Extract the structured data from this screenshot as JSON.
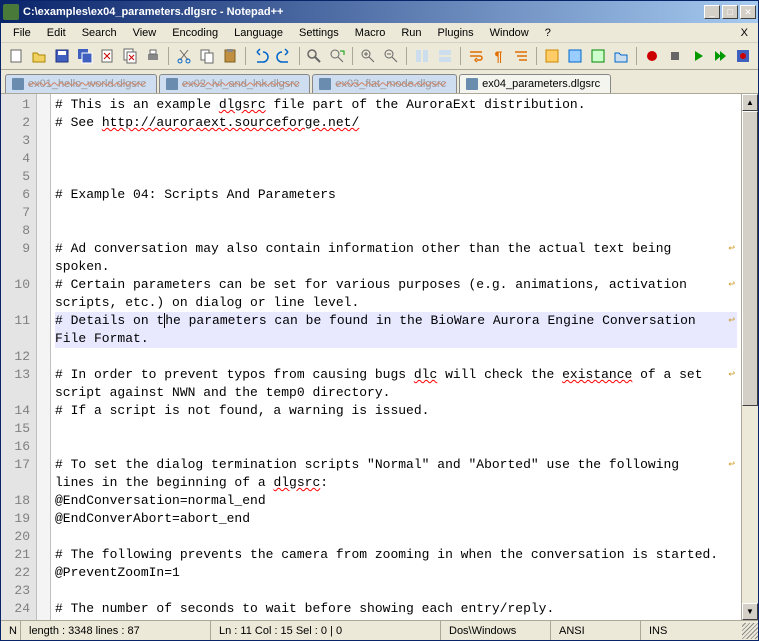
{
  "window": {
    "title": "C:\\examples\\ex04_parameters.dlgsrc - Notepad++"
  },
  "menu": {
    "items": [
      "File",
      "Edit",
      "Search",
      "View",
      "Encoding",
      "Language",
      "Settings",
      "Macro",
      "Run",
      "Plugins",
      "Window",
      "?"
    ],
    "close_x": "X"
  },
  "tabs": [
    {
      "label": "ex01_hello_world.dlgsrc",
      "active": false
    },
    {
      "label": "ex02_lvl_and_lnk.dlgsrc",
      "active": false
    },
    {
      "label": "ex03_flat_mode.dlgsrc",
      "active": false
    },
    {
      "label": "ex04_parameters.dlgsrc",
      "active": true
    }
  ],
  "editor": {
    "lines": [
      {
        "n": 1,
        "text": "# This is an example ",
        "spell": "dlgsrc",
        "rest": " file part of the AuroraExt distribution."
      },
      {
        "n": 2,
        "text": "# See ",
        "spell": "http://auroraext.sourceforge.net/",
        "rest": ""
      },
      {
        "n": 3,
        "text": ""
      },
      {
        "n": 4,
        "text": ""
      },
      {
        "n": 5,
        "text": ""
      },
      {
        "n": 6,
        "text": "# Example 04: Scripts And Parameters"
      },
      {
        "n": 7,
        "text": ""
      },
      {
        "n": 8,
        "text": ""
      },
      {
        "n": 9,
        "text": "# Ad conversation may also contain information other than the actual text being",
        "wrap": true
      },
      {
        "n": "",
        "text": "spoken."
      },
      {
        "n": 10,
        "text": "# Certain parameters can be set for various purposes (e.g. animations, activation",
        "wrap": true
      },
      {
        "n": "",
        "text": "scripts, etc.) on dialog or line level."
      },
      {
        "n": 11,
        "text": "# Details on the parameters can be found in the BioWare Aurora Engine Conversation",
        "current": true,
        "wrap": true,
        "cursor_at": 14
      },
      {
        "n": "",
        "text": "File Format.",
        "current": true
      },
      {
        "n": 12,
        "text": ""
      },
      {
        "n": 13,
        "text": "# In order to prevent typos from causing bugs ",
        "spell": "dlc",
        "rest": " will check the ",
        "spell2": "existance",
        "rest2": " of a set",
        "wrap": true
      },
      {
        "n": "",
        "text": "script against NWN and the temp0 directory."
      },
      {
        "n": 14,
        "text": "# If a script is not found, a warning is issued."
      },
      {
        "n": 15,
        "text": ""
      },
      {
        "n": 16,
        "text": ""
      },
      {
        "n": 17,
        "text": "# To set the dialog termination scripts \"Normal\" and \"Aborted\" use the following",
        "wrap": true
      },
      {
        "n": "",
        "text": "lines in the beginning of a ",
        "spell": "dlgsrc",
        "rest": ":"
      },
      {
        "n": 18,
        "text": "@EndConversation=normal_end"
      },
      {
        "n": 19,
        "text": "@EndConverAbort=abort_end"
      },
      {
        "n": 20,
        "text": ""
      },
      {
        "n": 21,
        "text": "# The following prevents the camera from zooming in when the conversation is started."
      },
      {
        "n": 22,
        "text": "@PreventZoomIn=1"
      },
      {
        "n": 23,
        "text": ""
      },
      {
        "n": 24,
        "text": "# The number of seconds to wait before showing each entry/reply."
      }
    ]
  },
  "status": {
    "grip": "N",
    "length": "length : 3348    lines : 87",
    "pos": "Ln : 11   Col : 15   Sel : 0 | 0",
    "eol": "Dos\\Windows",
    "enc": "ANSI",
    "mode": "INS"
  }
}
